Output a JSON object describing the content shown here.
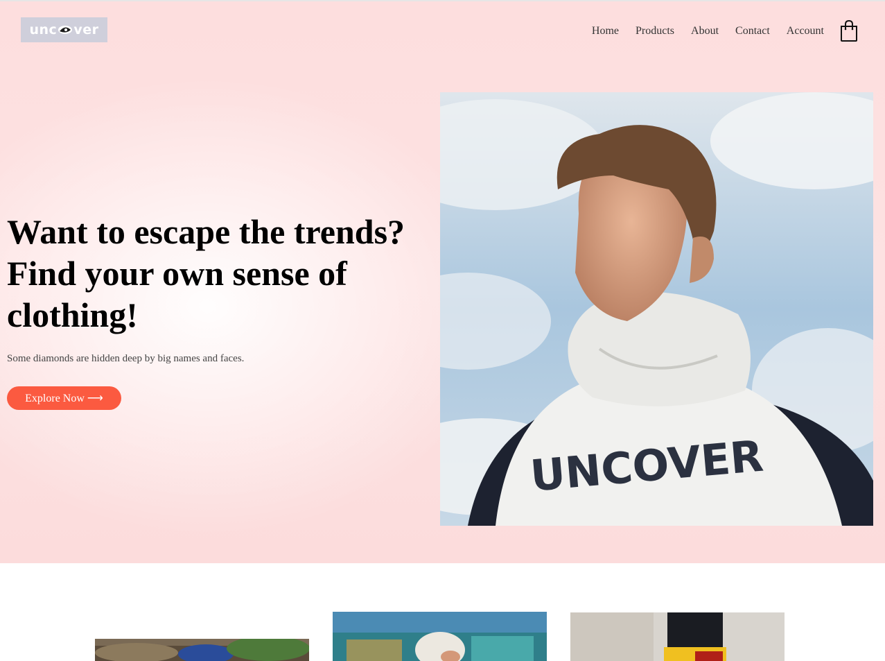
{
  "brand": {
    "logo_text_left": "unc",
    "logo_text_right": "ver",
    "logo_bg": "#cfcfdb"
  },
  "nav": {
    "items": [
      {
        "label": "Home"
      },
      {
        "label": "Products"
      },
      {
        "label": "About"
      },
      {
        "label": "Contact"
      },
      {
        "label": "Account"
      }
    ],
    "cart_icon": "shopping-bag-icon"
  },
  "hero": {
    "headline": "Want to escape the trends? Find your own sense of clothing!",
    "subtext": "Some diamonds are hidden deep by big names and faces.",
    "cta_label": "Explore Now ⟶",
    "accent_color": "#fb5a40",
    "hoodie_text": "UNCOVER"
  },
  "gallery": {
    "items": [
      {
        "name": "product-thumb-1"
      },
      {
        "name": "product-thumb-2"
      },
      {
        "name": "product-thumb-3"
      }
    ]
  }
}
